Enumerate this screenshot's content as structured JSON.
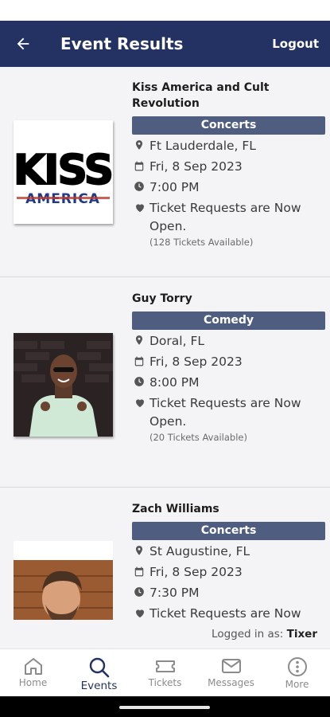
{
  "header": {
    "title": "Event Results",
    "logout_label": "Logout"
  },
  "events": [
    {
      "title": "Kiss America and Cult Revolution",
      "category": "Concerts",
      "location": "Ft Lauderdale, FL",
      "date": "Fri, 8 Sep 2023",
      "time": "7:00 PM",
      "status": "Ticket Requests are Now Open.",
      "available": "(128 Tickets Available)",
      "image_text_top": "KISS",
      "image_text_bottom": "AMERICA"
    },
    {
      "title": "Guy Torry",
      "category": "Comedy",
      "location": "Doral, FL",
      "date": "Fri, 8 Sep 2023",
      "time": "8:00 PM",
      "status": "Ticket Requests are Now Open.",
      "available": "(20 Tickets Available)"
    },
    {
      "title": "Zach Williams",
      "category": "Concerts",
      "location": "St Augustine, FL",
      "date": "Fri, 8 Sep 2023",
      "time": "7:30 PM",
      "status": "Ticket Requests are Now Open."
    }
  ],
  "footer": {
    "logged_in_prefix": "Logged in as:",
    "username": "Tixer"
  },
  "tabs": [
    {
      "label": "Home",
      "icon": "home-icon"
    },
    {
      "label": "Events",
      "icon": "search-icon",
      "active": true
    },
    {
      "label": "Tickets",
      "icon": "ticket-icon"
    },
    {
      "label": "Messages",
      "icon": "mail-icon"
    },
    {
      "label": "More",
      "icon": "more-icon"
    }
  ],
  "colors": {
    "header_bg": "#233262",
    "category_bg": "#4f5d80",
    "active_tab": "#233262"
  }
}
